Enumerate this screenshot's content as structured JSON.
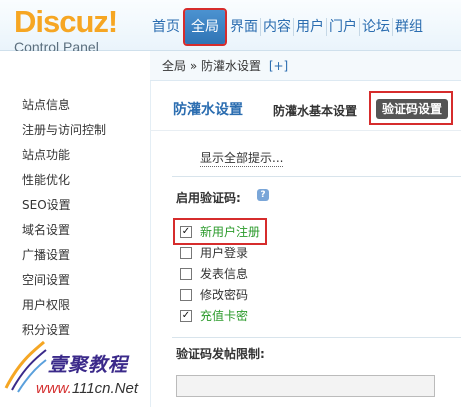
{
  "logo": {
    "main": "Discuz!",
    "sub": "Control Panel"
  },
  "nav": {
    "items": [
      "首页",
      "全局",
      "界面",
      "内容",
      "用户",
      "门户",
      "论坛",
      "群组"
    ],
    "active_index": 1
  },
  "breadcrumb": {
    "text": "全局 » 防灌水设置",
    "action": "[+]"
  },
  "sidebar": {
    "items": [
      "站点信息",
      "注册与访问控制",
      "站点功能",
      "性能优化",
      "SEO设置",
      "域名设置",
      "广播设置",
      "空间设置",
      "用户权限",
      "积分设置"
    ]
  },
  "main": {
    "title": "防灌水设置",
    "tabs": [
      "防灌水基本设置",
      "验证码设置"
    ],
    "active_tab": 1,
    "show_tips": "显示全部提示...",
    "enable_label": "启用验证码:",
    "help_icon": "?",
    "options": [
      {
        "label": "新用户注册",
        "checked": true
      },
      {
        "label": "用户登录",
        "checked": false
      },
      {
        "label": "发表信息",
        "checked": false
      },
      {
        "label": "修改密码",
        "checked": false
      },
      {
        "label": "充值卡密",
        "checked": true
      }
    ],
    "limit_label": "验证码发帖限制:",
    "limit_value": ""
  },
  "watermark": {
    "brand": "壹聚教程",
    "site_red": "www.",
    "site_dark": "111cn.Net"
  },
  "colors": {
    "accent": "#2b6db0",
    "logo": "#f6a623",
    "highlight": "#d62c2c",
    "checked_text": "#2a9a2a"
  }
}
